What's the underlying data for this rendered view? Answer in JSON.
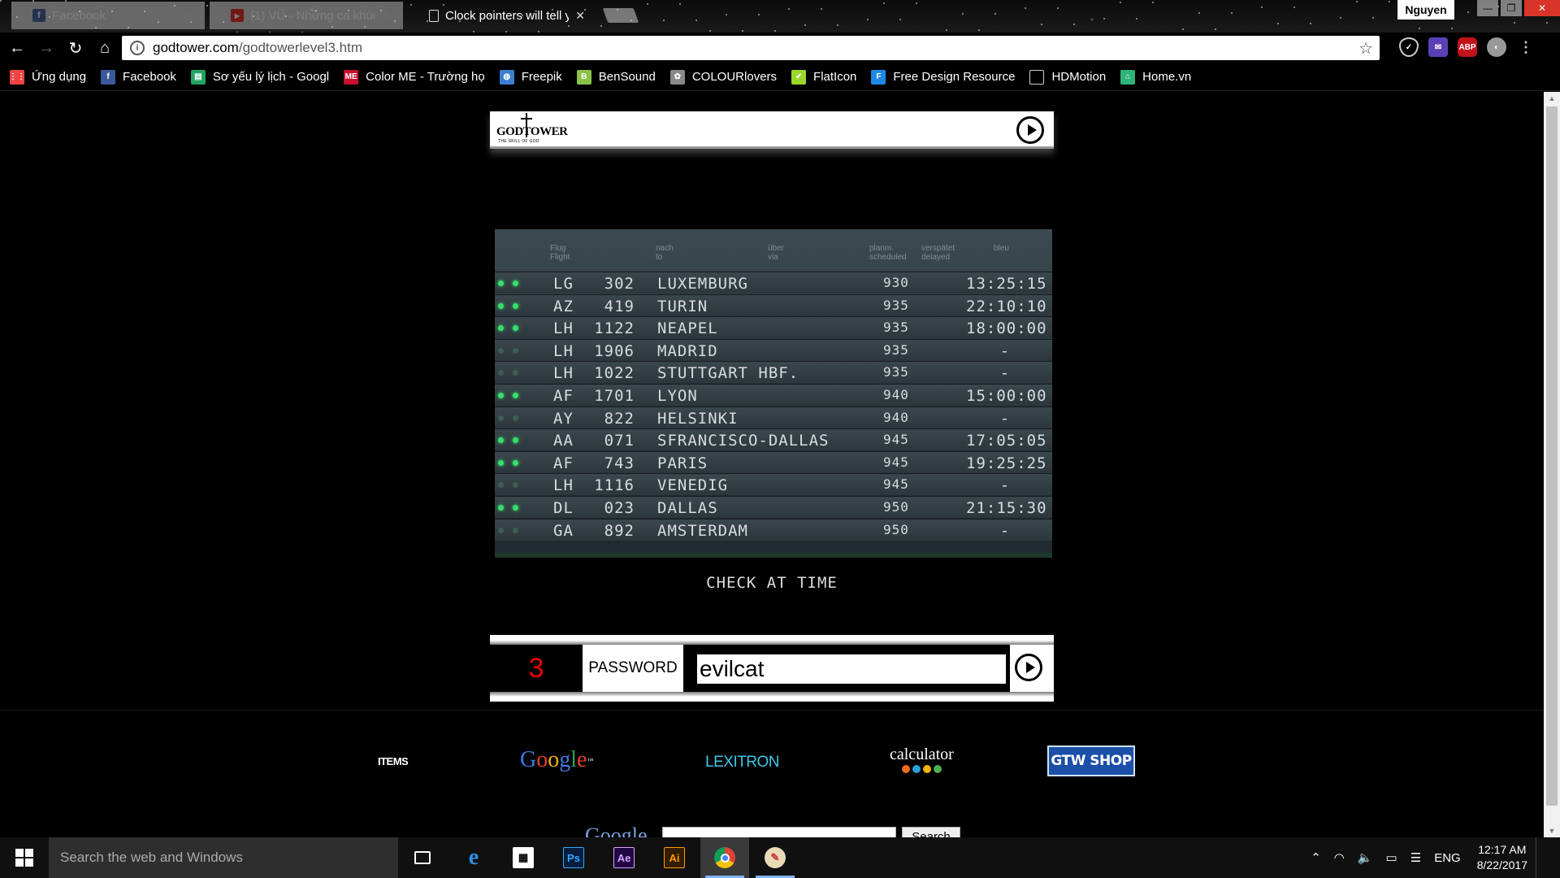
{
  "browser": {
    "tabs": [
      {
        "title": "Facebook",
        "icon": "facebook-icon",
        "active": false
      },
      {
        "title": "(1) VŨ - Những ca khúc",
        "icon": "youtube-icon",
        "active": false
      },
      {
        "title": "Clock pointers will tell yo",
        "icon": "page-icon",
        "active": true
      }
    ],
    "profile_name": "Nguyen",
    "address": {
      "host": "godtower.com",
      "path": "/godtowerlevel3.htm"
    },
    "bookmarks": [
      {
        "label": "Ứng dụng",
        "icon": "apps-grid-icon",
        "color": "#e44"
      },
      {
        "label": "Facebook",
        "icon": "facebook-icon",
        "color": "#3b5998"
      },
      {
        "label": "Sơ yếu lý lịch - Googl",
        "icon": "sheets-icon",
        "color": "#1fa463"
      },
      {
        "label": "Color ME - Trường họ",
        "icon": "colorme-icon",
        "color": "#c8102e"
      },
      {
        "label": "Freepik",
        "icon": "freepik-icon",
        "color": "#3b7ed0"
      },
      {
        "label": "BenSound",
        "icon": "bensound-icon",
        "color": "#8bc34a"
      },
      {
        "label": "COLOURlovers",
        "icon": "colourlovers-icon",
        "color": "#888"
      },
      {
        "label": "FlatIcon",
        "icon": "flaticon-icon",
        "color": "#9bd72a"
      },
      {
        "label": "Free Design Resource",
        "icon": "freedesign-icon",
        "color": "#1e88e5"
      },
      {
        "label": "HDMotion",
        "icon": "page-icon",
        "color": "#444"
      },
      {
        "label": "Home.vn",
        "icon": "homevn-icon",
        "color": "#2db37a"
      }
    ]
  },
  "page": {
    "logo_text": "GODTOWER",
    "logo_tagline": "THE SKILL OF GOD",
    "board": {
      "headers": [
        {
          "text": "Flug\nFlight"
        },
        {
          "text": "nach\nto"
        },
        {
          "text": "über\nvia"
        },
        {
          "text": "planm.\nscheduled"
        },
        {
          "text": "verspätet\ndelayed"
        },
        {
          "text": "bleu"
        }
      ],
      "rows": [
        {
          "lights": "on",
          "airline": "LG",
          "flight": "302",
          "dest": "LUXEMBURG",
          "sched": "930",
          "time": "13:25:15"
        },
        {
          "lights": "on",
          "airline": "AZ",
          "flight": "419",
          "dest": "TURIN",
          "sched": "935",
          "time": "22:10:10"
        },
        {
          "lights": "on",
          "airline": "LH",
          "flight": "1122",
          "dest": "NEAPEL",
          "sched": "935",
          "time": "18:00:00"
        },
        {
          "lights": "off",
          "airline": "LH",
          "flight": "1906",
          "dest": "MADRID",
          "sched": "935",
          "time": "-"
        },
        {
          "lights": "off",
          "airline": "LH",
          "flight": "1022",
          "dest": "STUTTGART HBF.",
          "sched": "935",
          "time": "-"
        },
        {
          "lights": "on",
          "airline": "AF",
          "flight": "1701",
          "dest": "LYON",
          "sched": "940",
          "time": "15:00:00"
        },
        {
          "lights": "off",
          "airline": "AY",
          "flight": "822",
          "dest": "HELSINKI",
          "sched": "940",
          "time": "-"
        },
        {
          "lights": "on",
          "airline": "AA",
          "flight": "071",
          "dest": "SFRANCISCO-DALLAS",
          "sched": "945",
          "time": "17:05:05"
        },
        {
          "lights": "on",
          "airline": "AF",
          "flight": "743",
          "dest": "PARIS",
          "sched": "945",
          "time": "19:25:25"
        },
        {
          "lights": "off",
          "airline": "LH",
          "flight": "1116",
          "dest": "VENEDIG",
          "sched": "945",
          "time": "-"
        },
        {
          "lights": "on",
          "airline": "DL",
          "flight": "023",
          "dest": "DALLAS",
          "sched": "950",
          "time": "21:15:30"
        },
        {
          "lights": "off",
          "airline": "GA",
          "flight": "892",
          "dest": "AMSTERDAM",
          "sched": "950",
          "time": "-"
        }
      ]
    },
    "caption": "CHECK AT TIME",
    "level_number": "3",
    "password_label": "PASSWORD",
    "password_value": "evilcat",
    "footer": {
      "items_label": "ITEMS",
      "google_label": "Google",
      "lexitron_label": "LEXITRON",
      "calculator_label": "calculator",
      "shop_label": "GTW SHOP",
      "search_logo": "Google",
      "search_button": "Search"
    }
  },
  "taskbar": {
    "search_placeholder": "Search the web and Windows",
    "language": "ENG",
    "time": "12:17 AM",
    "date": "8/22/2017"
  }
}
